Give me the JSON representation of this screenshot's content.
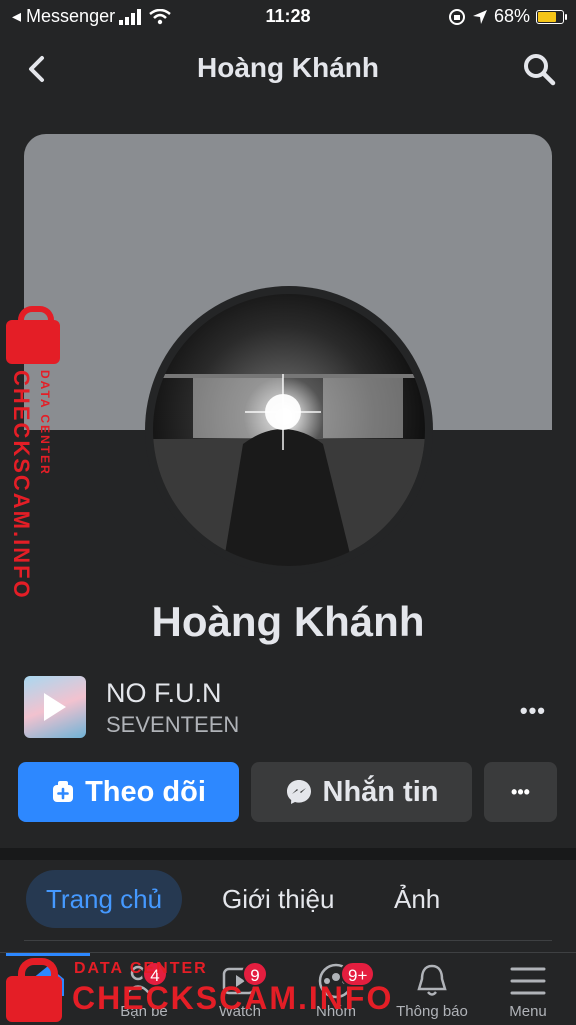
{
  "status_bar": {
    "carrier": "◂ Messenger",
    "time": "11:28",
    "battery": "68%"
  },
  "header": {
    "title": "Hoàng Khánh"
  },
  "profile": {
    "name": "Hoàng Khánh"
  },
  "music": {
    "title": "NO F.U.N",
    "artist": "SEVENTEEN",
    "more": "•••"
  },
  "actions": {
    "follow_label": "Theo dõi",
    "message_label": "Nhắn tin",
    "more_label": "•••"
  },
  "tabs": [
    {
      "label": "Trang chủ"
    },
    {
      "label": "Giới thiệu"
    },
    {
      "label": "Ảnh"
    }
  ],
  "bottom_nav": [
    {
      "label": "tin",
      "icon": "home-icon"
    },
    {
      "label": "Bạn bè",
      "icon": "friends-icon",
      "badge": "4"
    },
    {
      "label": "Watch",
      "icon": "watch-icon",
      "badge": "9"
    },
    {
      "label": "Nhóm",
      "icon": "groups-icon",
      "badge": "9+"
    },
    {
      "label": "Thông báo",
      "icon": "bell-icon"
    },
    {
      "label": "Menu",
      "icon": "menu-icon"
    }
  ],
  "watermark": {
    "main": "CHECKSCAM.INFO",
    "sub": "DATA CENTER"
  },
  "colors": {
    "background": "#242526",
    "accent": "#2d88ff",
    "badge": "#e41e3f",
    "watermark": "#e41e26"
  }
}
